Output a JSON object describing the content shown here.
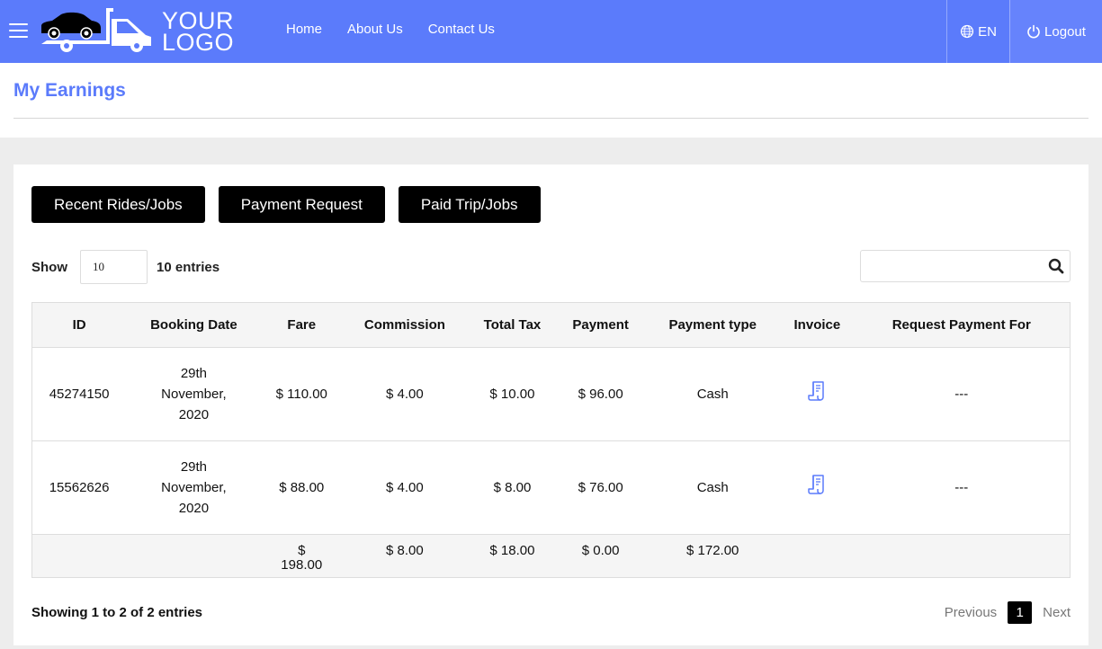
{
  "header": {
    "logo_line1": "YOUR",
    "logo_line2": "LOGO",
    "nav": [
      {
        "label": "Home"
      },
      {
        "label": "About Us"
      },
      {
        "label": "Contact Us"
      }
    ],
    "language": "EN",
    "logout": "Logout",
    "brand_color": "#5b7bfb"
  },
  "page": {
    "title": "My Earnings"
  },
  "tabs": [
    {
      "label": "Recent Rides/Jobs"
    },
    {
      "label": "Payment Request"
    },
    {
      "label": "Paid Trip/Jobs"
    }
  ],
  "length": {
    "show_label": "Show",
    "value": "10",
    "suffix": "10 entries"
  },
  "search": {
    "value": "",
    "placeholder": ""
  },
  "table": {
    "headers": [
      "ID",
      "Booking Date",
      "Fare",
      "Commission",
      "Total Tax",
      "Payment",
      "Payment type",
      "Invoice",
      "Request Payment For"
    ],
    "rows": [
      {
        "id": "45274150",
        "date_l1": "29th",
        "date_l2": "November,",
        "date_l3": "2020",
        "fare": "$ 110.00",
        "commission": "$ 4.00",
        "tax": "$ 10.00",
        "payment": "$ 96.00",
        "type": "Cash",
        "invoice_icon": "receipt-icon",
        "request": "---"
      },
      {
        "id": "15562626",
        "date_l1": "29th",
        "date_l2": "November,",
        "date_l3": "2020",
        "fare": "$ 88.00",
        "commission": "$ 4.00",
        "tax": "$ 8.00",
        "payment": "$ 76.00",
        "type": "Cash",
        "invoice_icon": "receipt-icon",
        "request": "---"
      }
    ],
    "totals": {
      "fare_l1": "$",
      "fare_l2": "198.00",
      "commission": "$ 8.00",
      "tax": "$ 18.00",
      "payment": "$ 0.00",
      "type": "$ 172.00"
    }
  },
  "footer": {
    "info": "Showing 1 to 2 of 2 entries",
    "previous": "Previous",
    "current_page": "1",
    "next": "Next"
  }
}
